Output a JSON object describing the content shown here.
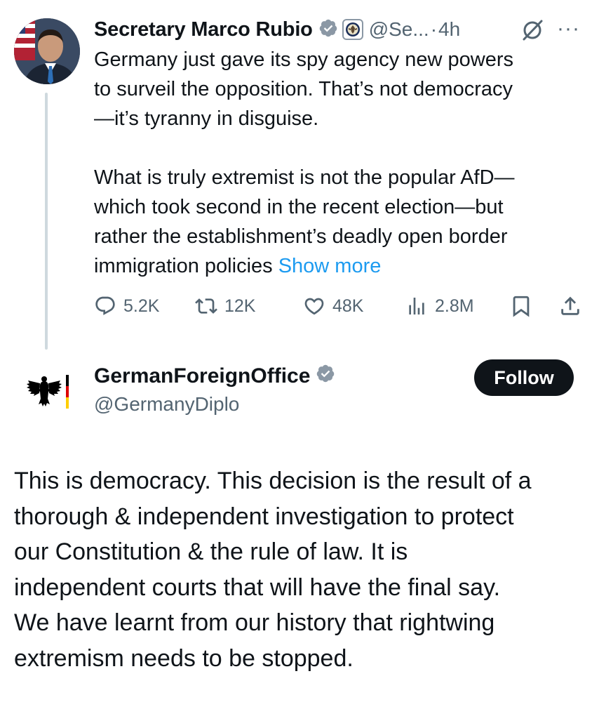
{
  "quoted_post": {
    "author_name": "Secretary Marco Rubio",
    "handle": "@Se...",
    "separator": "·",
    "time": "4h",
    "text_p1": "Germany just gave its spy agency new powers\nto surveil the opposition.  That’s not democracy\n—it’s tyranny in disguise.",
    "text_p2": "What is truly extremist is not the popular AfD—\nwhich took second in the recent election—but\nrather the establishment’s deadly open border\nimmigration policies ",
    "show_more": "Show more",
    "stats": {
      "replies": "5.2K",
      "reposts": "12K",
      "likes": "48K",
      "views": "2.8M"
    }
  },
  "main_post": {
    "author_name": "GermanForeignOffice",
    "handle": "@GermanyDiplo",
    "follow_label": "Follow",
    "text": "This is democracy. This decision is the result of a\nthorough & independent investigation to protect\nour Constitution & the rule of law. It is\nindependent courts that will have the final say.\nWe have learnt from our history that rightwing\nextremism needs to be stopped."
  },
  "colors": {
    "verified_gray": "#8b98a5",
    "link_blue": "#1d9bf0",
    "secondary_text": "#536471",
    "follow_bg": "#0f1419"
  }
}
